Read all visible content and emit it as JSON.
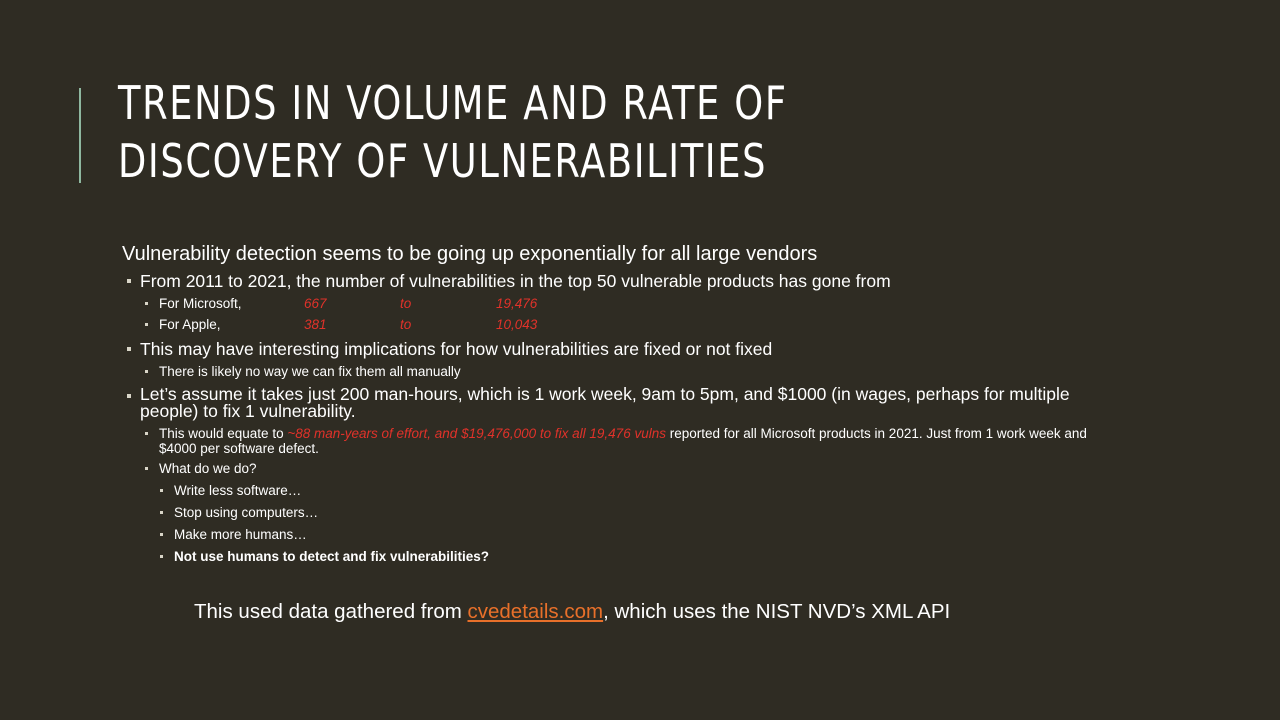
{
  "title": "Trends in Volume and Rate of Discovery of Vulnerabilities",
  "intro": "Vulnerability detection seems to be going up exponentially for all large vendors",
  "b1": "From 2011 to 2021, the number of vulnerabilities in the top 50 vulnerable products has gone from",
  "ms": {
    "label": "For Microsoft,",
    "from": "667",
    "to": "to",
    "value": "19,476"
  },
  "apple": {
    "label": "For Apple,",
    "from": "381",
    "to": "to",
    "value": "10,043"
  },
  "b2": "This may have interesting implications for how vulnerabilities are fixed or not fixed",
  "b2a": "There is likely no way we can fix them all manually",
  "b3": "Let’s assume it takes just 200 man-hours, which is 1 work week, 9am to 5pm, and $1000 (in wages, perhaps for multiple people) to fix 1 vulnerability.",
  "b3a": {
    "pre": "This would equate to ",
    "red": "~88 man-years of effort, and $19,476,000 to fix all 19,476 vulns",
    "post": " reported for all Microsoft products in 2021.  Just from 1 work week and $4000 per software defect."
  },
  "b3b": "What do we do?",
  "opts": [
    "Write less software…",
    "Stop using computers…",
    "Make more humans…",
    "Not use humans to detect and fix vulnerabilities?"
  ],
  "footer": {
    "pre": "This used data gathered from ",
    "link": "cvedetails.com",
    "post": ", which uses the NIST NVD’s XML API"
  },
  "colors": {
    "background": "#2f2c23",
    "accent": "#8fb8a0",
    "highlight": "#e0322a",
    "link": "#e8702a"
  }
}
